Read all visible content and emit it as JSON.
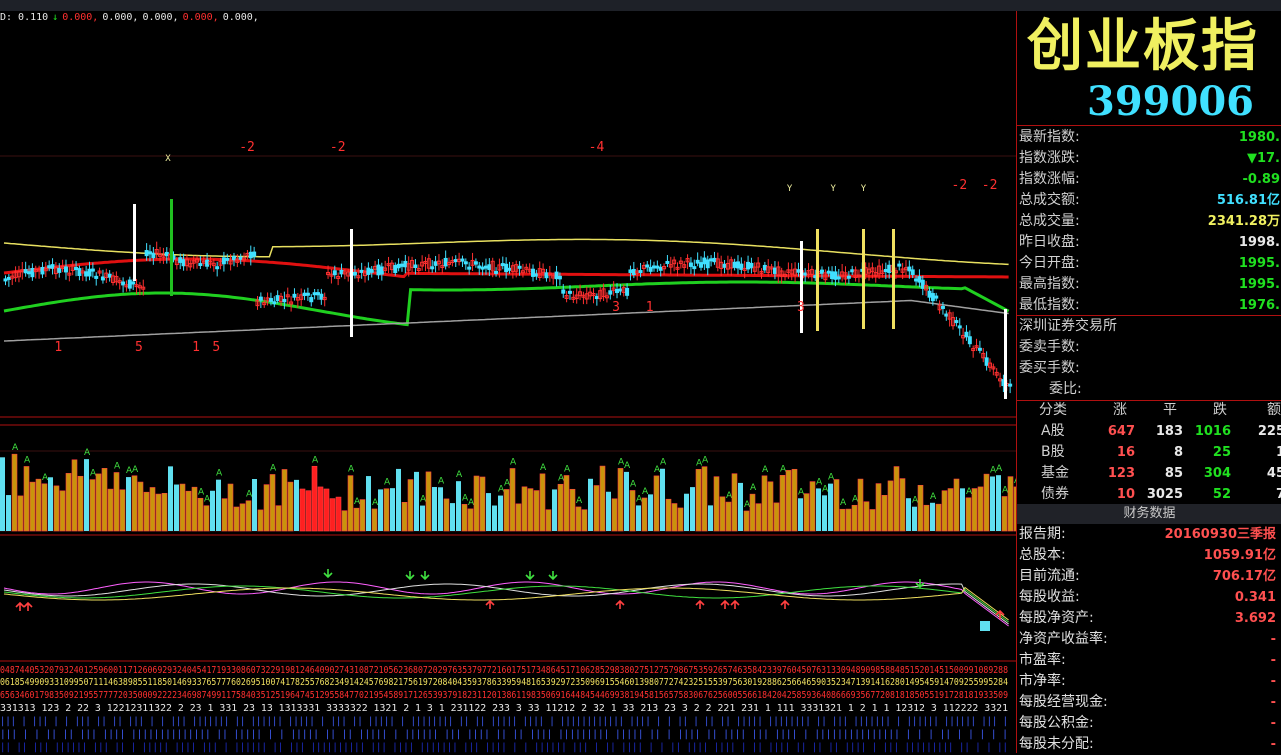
{
  "colors": {
    "background": "#000000",
    "up": "#ff3030",
    "down": "#40e0ff",
    "ma_yellow": "#e8e060",
    "ma_red": "#e01010",
    "ma_green": "#20d020",
    "ma_gray": "#a0a0a0",
    "volume_gold": "#c8940c",
    "divider": "#b01010"
  },
  "indicator_line": [
    {
      "text": "D: 0.110",
      "color": "white"
    },
    {
      "text": "↓",
      "color": "green"
    },
    {
      "text": "0.000,",
      "color": "red"
    },
    {
      "text": "0.000,",
      "color": "white"
    },
    {
      "text": "0.000,",
      "color": "white"
    },
    {
      "text": "0.000,",
      "color": "red"
    },
    {
      "text": "0.000,",
      "color": "white"
    }
  ],
  "price_marks": [
    {
      "text": "X",
      "slot": 48
    },
    {
      "text": "-2",
      "slot": 70
    },
    {
      "text": "-2",
      "slot": 97
    },
    {
      "text": "-4",
      "slot": 174
    },
    {
      "text": "Y",
      "slot": 233
    },
    {
      "text": "Y",
      "slot": 246
    },
    {
      "text": "Y",
      "slot": 255
    },
    {
      "text": "-2",
      "slot": 282
    },
    {
      "text": "-2",
      "slot": 291
    },
    {
      "text": "1",
      "slot": 15
    },
    {
      "text": "5",
      "slot": 39
    },
    {
      "text": "1",
      "slot": 56
    },
    {
      "text": "5",
      "slot": 62
    },
    {
      "text": "3",
      "slot": 181
    },
    {
      "text": "1",
      "slot": 191
    },
    {
      "text": "3",
      "slot": 236
    }
  ],
  "header": {
    "title": "创业板指",
    "code": "399006"
  },
  "quote": [
    {
      "label": "最新指数:",
      "value": "1980.",
      "color": "#20e020"
    },
    {
      "label": "指数涨跌:",
      "value": "▼17.",
      "color": "#20e020"
    },
    {
      "label": "指数涨幅:",
      "value": "-0.89",
      "color": "#20e020"
    },
    {
      "label": "总成交额:",
      "value": "516.81亿",
      "color": "#40e0ff"
    },
    {
      "label": "总成交量:",
      "value": "2341.28万",
      "color": "#f0f060"
    },
    {
      "label": "昨日收盘:",
      "value": "1998.",
      "color": "#e8e8e8"
    },
    {
      "label": "今日开盘:",
      "value": "1995.",
      "color": "#20e020"
    },
    {
      "label": "最高指数:",
      "value": "1995.",
      "color": "#20e020"
    },
    {
      "label": "最低指数:",
      "value": "1976.",
      "color": "#20e020"
    }
  ],
  "exchange": {
    "name": "深圳证券交易所",
    "sell_label": "委卖手数:",
    "buy_label": "委买手数:",
    "ratio_label": "委比:"
  },
  "categories": {
    "headers": [
      "分类",
      "涨",
      "平",
      "跌",
      "额(亿"
    ],
    "rows": [
      {
        "name": "A股",
        "up": "647",
        "flat": "183",
        "down": "1016",
        "amount": "225"
      },
      {
        "name": "B股",
        "up": "16",
        "flat": "8",
        "down": "25",
        "amount": "1"
      },
      {
        "name": "基金",
        "up": "123",
        "flat": "85",
        "down": "304",
        "amount": "45"
      },
      {
        "name": "债券",
        "up": "10",
        "flat": "3025",
        "down": "52",
        "amount": "7"
      }
    ]
  },
  "financial": {
    "title": "财务数据",
    "rows": [
      {
        "label": "报告期:",
        "value": "20160930三季报"
      },
      {
        "label": "总股本:",
        "value": "1059.91亿"
      },
      {
        "label": "目前流通:",
        "value": "706.17亿"
      },
      {
        "label": "每股收益:",
        "value": "0.341"
      },
      {
        "label": "每股净资产:",
        "value": "3.692"
      },
      {
        "label": "净资产收益率:",
        "value": "-"
      },
      {
        "label": "市盈率:",
        "value": "-"
      },
      {
        "label": "市净率:",
        "value": "-"
      },
      {
        "label": "每股经营现金:",
        "value": "-"
      },
      {
        "label": "每股公积金:",
        "value": "-"
      },
      {
        "label": "每股未分配:",
        "value": "-"
      }
    ]
  }
}
